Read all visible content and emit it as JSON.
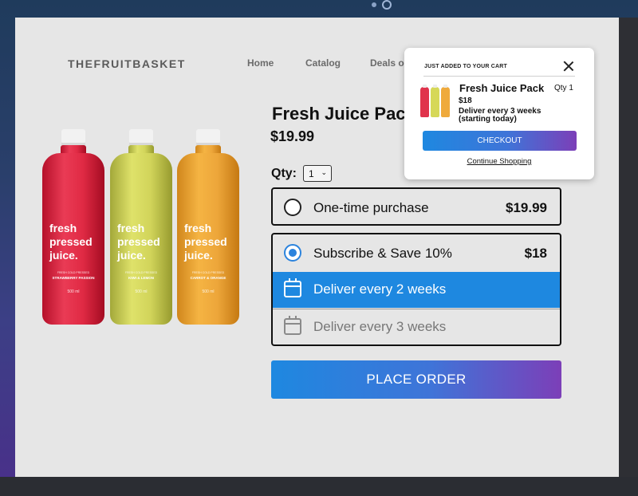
{
  "site": {
    "logo": "THEFRUITBASKET",
    "nav": [
      "Home",
      "Catalog",
      "Deals o"
    ]
  },
  "bottles": [
    {
      "label": "fresh pressed juice.",
      "tagline": "FRESH COLD PRESSED",
      "flavor": "STRAWBERRY PASSION",
      "volume": "500 ml",
      "color": "#e02a44"
    },
    {
      "label": "fresh pressed juice.",
      "tagline": "FRESH COLD PRESSED",
      "flavor": "KIWI & LEMON",
      "volume": "500 ml",
      "color": "#d1d45a"
    },
    {
      "label": "fresh pressed juice.",
      "tagline": "FRESH COLD PRESSED",
      "flavor": "CARROT & ORANGE",
      "volume": "500 ml",
      "color": "#eda63a"
    }
  ],
  "product": {
    "title": "Fresh Juice Pack",
    "price": "$19.99",
    "qty_label": "Qty:",
    "qty_value": "1"
  },
  "options": {
    "one_time": {
      "label": "One-time purchase",
      "price": "$19.99",
      "selected": false
    },
    "subscribe": {
      "label": "Subscribe & Save 10%",
      "price": "$18",
      "selected": true
    },
    "frequencies": [
      {
        "label": "Deliver every 2 weeks",
        "selected": true
      },
      {
        "label": "Deliver every 3 weeks",
        "selected": false
      }
    ]
  },
  "place_order_label": "PLACE ORDER",
  "cart_popup": {
    "title": "JUST ADDED TO YOUR CART",
    "item_name": "Fresh Juice Pack",
    "qty": "Qty 1",
    "price": "$18",
    "delivery": "Deliver every 3 weeks (starting today)",
    "checkout_label": "CHECKOUT",
    "continue_label": "Continue Shopping"
  },
  "colors": {
    "accent_blue": "#1e88e0",
    "accent_purple": "#7c3fb8",
    "page_bg": "#e6e6e6"
  }
}
